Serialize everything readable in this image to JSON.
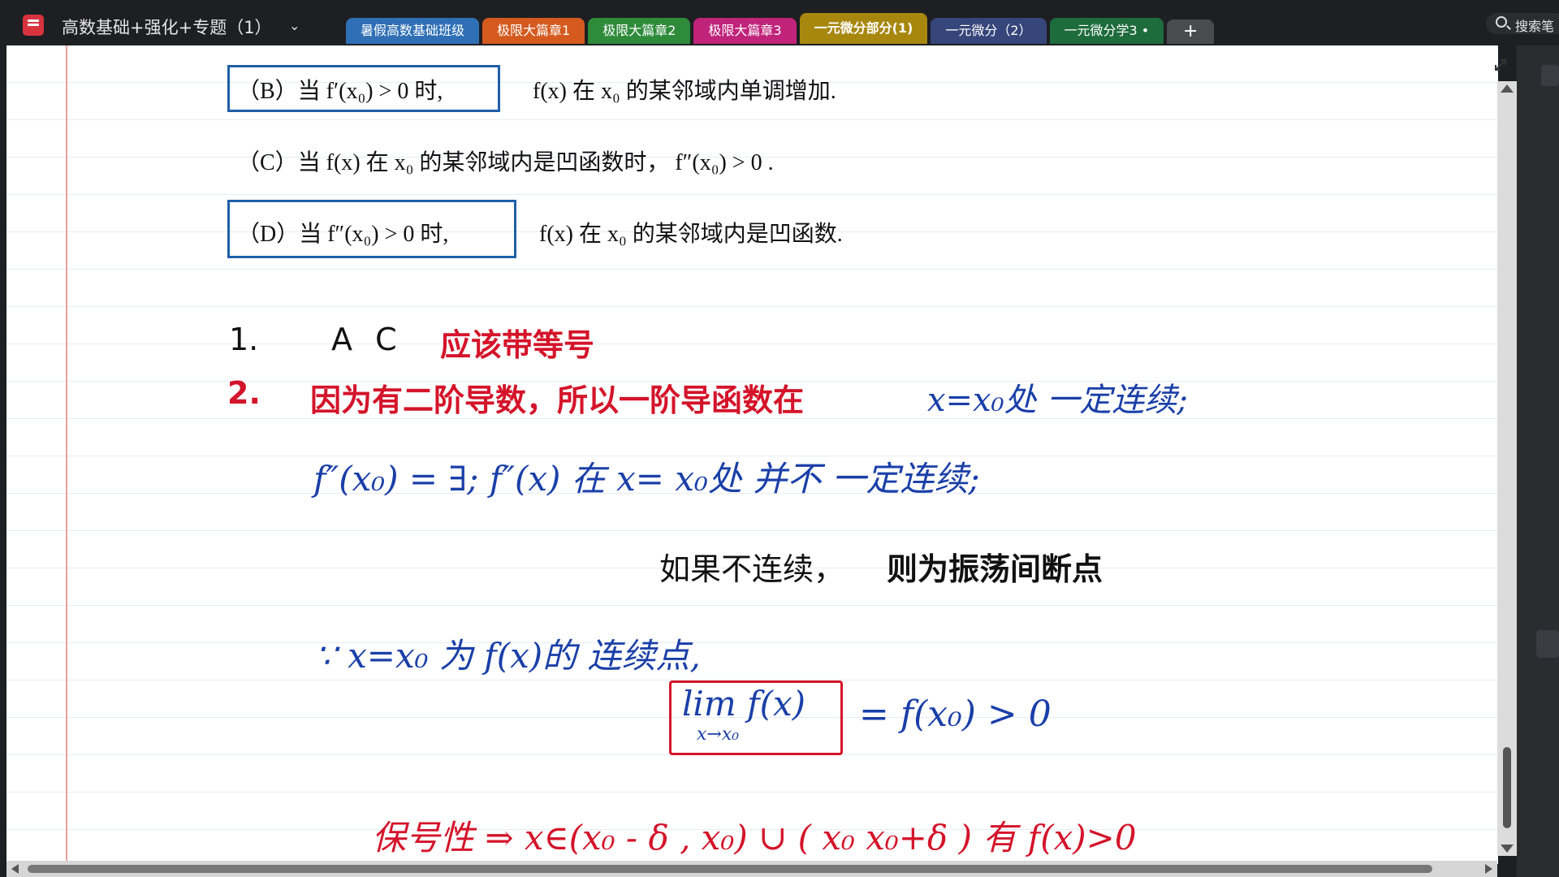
{
  "app": {
    "notebook_title": "高数基础+强化+专题（1）",
    "search_label": "搜索笔"
  },
  "tabs": [
    {
      "label": "暑假高数基础班级",
      "color": "#2f6fb5",
      "active": false
    },
    {
      "label": "极限大篇章1",
      "color": "#d45a1e",
      "active": false
    },
    {
      "label": "极限大篇章2",
      "color": "#2e8b3a",
      "active": false
    },
    {
      "label": "极限大篇章3",
      "color": "#c0237a",
      "active": false
    },
    {
      "label": "一元微分部分(1)",
      "color": "#a8870e",
      "active": true
    },
    {
      "label": "一元微分（2）",
      "color": "#36457a",
      "active": false
    },
    {
      "label": "一元微分学3 •",
      "color": "#1e6b3c",
      "active": false
    }
  ],
  "tab_add_label": "+",
  "options": {
    "b_boxed": "（B）当 f′(x₀) > 0 时,",
    "b_rest": "f(x) 在 x₀ 的某邻域内单调增加.",
    "c_text": "（C）当 f(x) 在 x₀ 的某邻域内是凹函数时， f″(x₀) > 0 .",
    "d_boxed": "（D）当 f″(x₀) > 0 时,",
    "d_rest": "f(x) 在 x₀ 的某邻域内是凹函数."
  },
  "notes": {
    "line1_num": "1.",
    "line1_letters": "A C",
    "line1_red": "应该带等号",
    "line2_num": "2.",
    "line2_red": "因为有二阶导数，所以一阶导函数在",
    "line2_hand": "x=x₀处 一定连续;",
    "line3_hand": "f″(x₀) = ∃;  f″(x) 在 x= x₀处 并不 一定连续;",
    "line4_black": "如果不连续，",
    "line4_bold": "则为振荡间断点",
    "line5_hand": "∵ x=x₀ 为 f(x)的 连续点,",
    "lim_expr": "lim f(x)",
    "lim_sub": "x→x₀",
    "lim_rhs": "= f(x₀) > 0",
    "line7_hand": "保号性 ⇒  x∈(x₀ - δ , x₀) ∪ ( x₀   x₀+δ )  有 f(x)>0"
  },
  "colors": {
    "box_blue": "#1f5fa8",
    "note_red": "#d4142a",
    "hand_blue": "#1a3fa8",
    "lim_box_red": "#d4142a"
  },
  "icons": {
    "notebook": "notebook-icon",
    "search": "search-icon",
    "expand": "expand-icon"
  }
}
